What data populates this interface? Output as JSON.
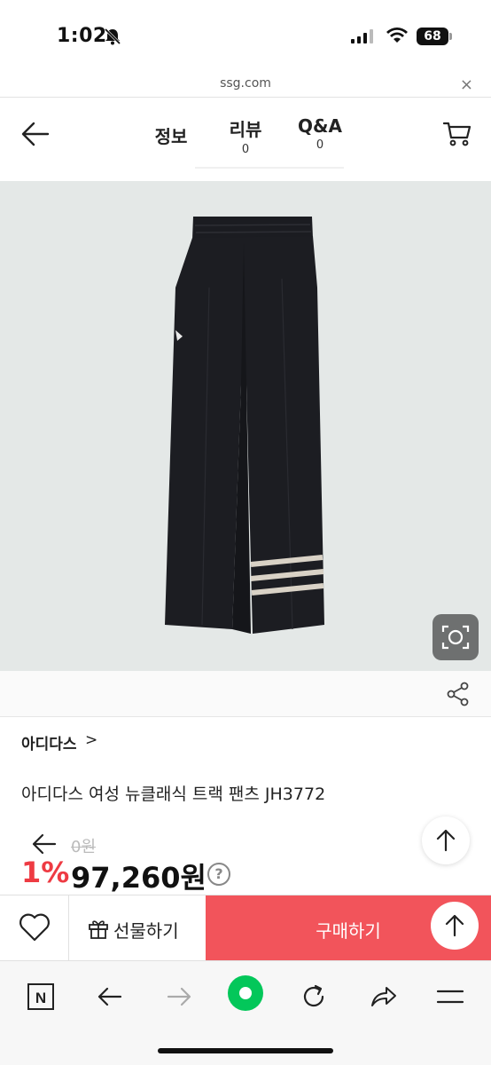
{
  "status_bar": {
    "time": "1:02",
    "battery": "68"
  },
  "url_bar": {
    "url": "ssg.com",
    "close": "×"
  },
  "header": {
    "tabs": [
      {
        "label": "정보",
        "count": ""
      },
      {
        "label": "리뷰",
        "count": "0"
      },
      {
        "label": "Q&A",
        "count": "0"
      }
    ]
  },
  "product": {
    "brand": "아디다스",
    "brand_chevron": ">",
    "title": "아디다스 여성 뉴클래식 트랙 팬츠 JH3772",
    "original_price": "0원",
    "discount": "1%",
    "price": "97,260원",
    "help": "?"
  },
  "actions": {
    "gift_label": "선물하기",
    "buy_label": "구매하기"
  },
  "browser_toolbar": {
    "tab_label": "N"
  },
  "colors": {
    "accent": "#f2545b",
    "discount": "#ee3b43",
    "naver_green": "#03c75a"
  }
}
